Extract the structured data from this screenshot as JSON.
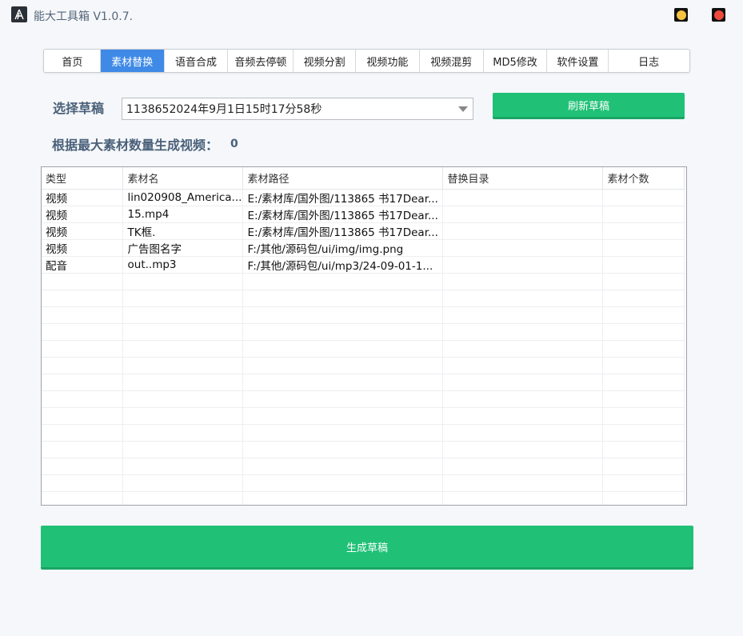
{
  "app": {
    "title": "能大工具箱 V1.0.7.",
    "min_color": "#f5c242",
    "close_color": "#f04a3d"
  },
  "tabs": [
    {
      "label": "首页",
      "active": false
    },
    {
      "label": "素材替换",
      "active": true
    },
    {
      "label": "语音合成",
      "active": false
    },
    {
      "label": "音频去停顿",
      "active": false
    },
    {
      "label": "视频分割",
      "active": false
    },
    {
      "label": "视频功能",
      "active": false
    },
    {
      "label": "视频混剪",
      "active": false
    },
    {
      "label": "MD5修改",
      "active": false
    },
    {
      "label": "软件设置",
      "active": false
    },
    {
      "label": "日志",
      "active": false
    }
  ],
  "draft": {
    "label": "选择草稿",
    "selected": "1138652024年9月1日15时17分58秒",
    "refresh_button": "刷新草稿"
  },
  "generate_info": {
    "label": "根据最大素材数量生成视频：",
    "count": "0"
  },
  "table": {
    "columns": [
      "类型",
      "素材名",
      "素材路径",
      "替换目录",
      "素材个数"
    ],
    "rows": [
      [
        "视频",
        "lin020908_America...",
        "E:/素材库/国外图/113865 书17Dear...",
        "",
        ""
      ],
      [
        "视频",
        "15.mp4",
        "E:/素材库/国外图/113865 书17Dear...",
        "",
        ""
      ],
      [
        "视频",
        "TK框.",
        "E:/素材库/国外图/113865 书17Dear...",
        "",
        ""
      ],
      [
        "视频",
        "广告图名字",
        "F:/其他/源码包/ui/img/img.png",
        "",
        ""
      ],
      [
        "配音",
        "out..mp3",
        "F:/其他/源码包/ui/mp3/24-09-01-1...",
        "",
        ""
      ]
    ]
  },
  "generate_button": "生成草稿",
  "accent": "#20c177",
  "tab_active_color": "#3f8ae6"
}
